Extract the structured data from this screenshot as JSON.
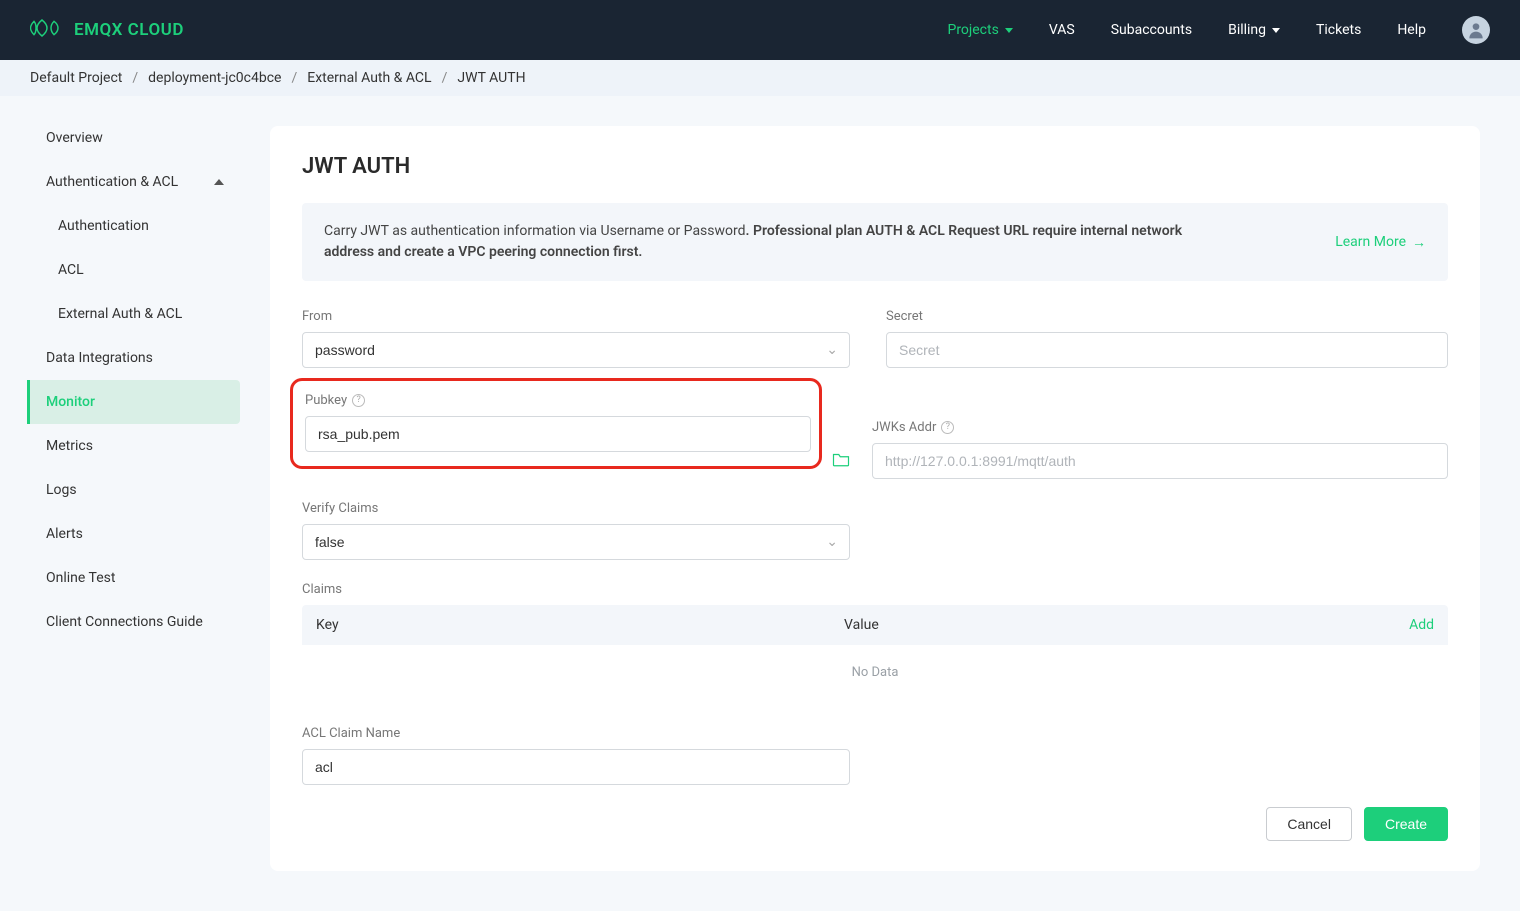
{
  "brand": "EMQX CLOUD",
  "nav": {
    "projects": "Projects",
    "vas": "VAS",
    "subaccounts": "Subaccounts",
    "billing": "Billing",
    "tickets": "Tickets",
    "help": "Help"
  },
  "breadcrumb": {
    "default_project": "Default Project",
    "deployment": "deployment-jc0c4bce",
    "ext_auth": "External Auth & ACL",
    "jwt": "JWT AUTH"
  },
  "sidebar": {
    "overview": "Overview",
    "auth_acl": "Authentication & ACL",
    "authentication": "Authentication",
    "acl": "ACL",
    "external": "External Auth & ACL",
    "data_int": "Data Integrations",
    "monitor": "Monitor",
    "metrics": "Metrics",
    "logs": "Logs",
    "alerts": "Alerts",
    "online_test": "Online Test",
    "client_conn": "Client Connections Guide"
  },
  "page": {
    "title": "JWT AUTH",
    "notice_plain": "Carry JWT as authentication information via Username or Password",
    "notice_bold": ". Professional plan AUTH & ACL Request URL require internal network address and create a VPC peering connection first.",
    "learn_more": "Learn More"
  },
  "form": {
    "from_label": "From",
    "from_value": "password",
    "secret_label": "Secret",
    "secret_placeholder": "Secret",
    "pubkey_label": "Pubkey",
    "pubkey_value": "rsa_pub.pem",
    "jwks_label": "JWKs Addr",
    "jwks_placeholder": "http://127.0.0.1:8991/mqtt/auth",
    "verify_label": "Verify Claims",
    "verify_value": "false",
    "claims_label": "Claims",
    "claims_key": "Key",
    "claims_value": "Value",
    "claims_add": "Add",
    "no_data": "No Data",
    "acl_claim_label": "ACL Claim Name",
    "acl_claim_value": "acl"
  },
  "buttons": {
    "cancel": "Cancel",
    "create": "Create"
  }
}
